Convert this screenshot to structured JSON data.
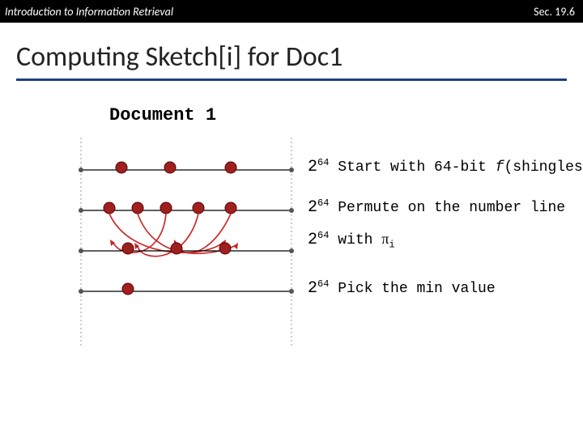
{
  "topbar": {
    "left": "Introduction to Information Retrieval",
    "right": "Sec. 19.6"
  },
  "title": "Computing Sketch[i] for Doc1",
  "doc_label": "Document 1",
  "rows": {
    "r1": {
      "base": "2",
      "sup": "64",
      "rest": " Start with 64-bit ",
      "em": "f",
      "tail": "(shingles)"
    },
    "r2": {
      "base": "2",
      "sup": "64",
      "rest": " Permute on the number line"
    },
    "r3": {
      "base": "2",
      "sup": "64",
      "rest": " with ",
      "pi": "π",
      "sub": "i"
    },
    "r4": {
      "base": "2",
      "sup": "64",
      "rest": " Pick the min value"
    }
  }
}
